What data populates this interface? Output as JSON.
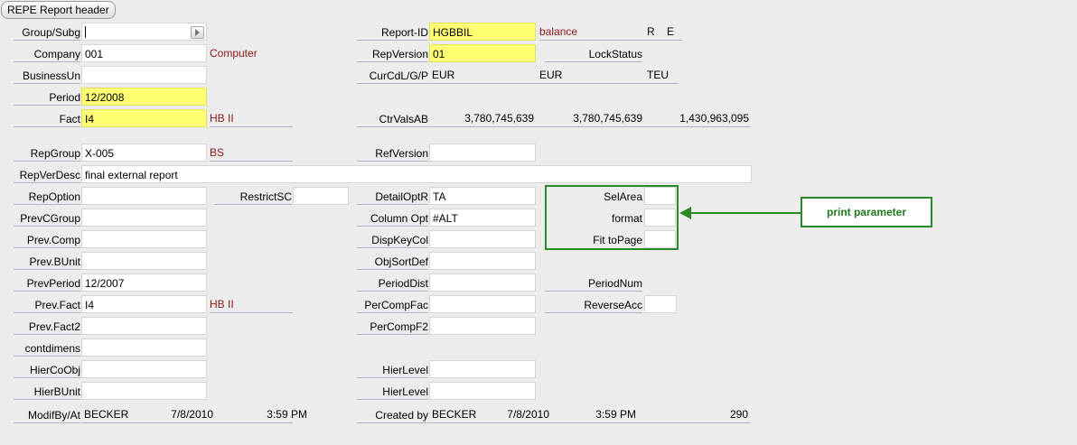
{
  "window": {
    "tab_title": "REPE Report header"
  },
  "left": {
    "group_subg": {
      "label": "Group/Subg",
      "value": ""
    },
    "company": {
      "label": "Company",
      "value": "001",
      "desc": "Computer"
    },
    "business_unit": {
      "label": "BusinessUn",
      "value": ""
    },
    "period": {
      "label": "Period",
      "value": "12/2008"
    },
    "fact": {
      "label": "Fact",
      "value": "I4",
      "desc": "HB II"
    },
    "rep_group": {
      "label": "RepGroup",
      "value": "X-005",
      "desc": "BS"
    },
    "rep_ver_desc": {
      "label": "RepVerDesc",
      "value": "final external report"
    },
    "rep_option": {
      "label": "RepOption",
      "value": ""
    },
    "restrict_sc": {
      "label": "RestrictSC",
      "value": ""
    },
    "prev_cgroup": {
      "label": "PrevCGroup",
      "value": ""
    },
    "prev_comp": {
      "label": "Prev.Comp",
      "value": ""
    },
    "prev_bunit": {
      "label": "Prev.BUnit",
      "value": ""
    },
    "prev_period": {
      "label": "PrevPeriod",
      "value": "12/2007"
    },
    "prev_fact": {
      "label": "Prev.Fact",
      "value": "I4",
      "desc": "HB II"
    },
    "prev_fact2": {
      "label": "Prev.Fact2",
      "value": ""
    },
    "contdimens": {
      "label": "contdimens",
      "value": ""
    },
    "hier_coobj": {
      "label": "HierCoObj",
      "value": ""
    },
    "hier_bunit": {
      "label": "HierBUnit",
      "value": ""
    },
    "modif": {
      "label": "ModifBy/At",
      "user": "BECKER",
      "date": "7/8/2010",
      "time": "3:59 PM"
    }
  },
  "right": {
    "report_id": {
      "label": "Report-ID",
      "value": "HGBBIL",
      "desc": "balance",
      "flag1": "R",
      "flag2": "E"
    },
    "rep_version": {
      "label": "RepVersion",
      "value": "01"
    },
    "lock_status": {
      "label": "LockStatus",
      "value": ""
    },
    "curcd": {
      "label": "CurCdL/G/P",
      "v1": "EUR",
      "v2": "EUR",
      "v3": "TEU"
    },
    "ctr_vals": {
      "label": "CtrValsAB",
      "v1": "3,780,745,639",
      "v2": "3,780,745,639",
      "v3": "1,430,963,095"
    },
    "ref_version": {
      "label": "RefVersion",
      "value": ""
    },
    "detail_optr": {
      "label": "DetailOptR",
      "value": "TA"
    },
    "column_opt": {
      "label": "Column Opt",
      "value": "#ALT"
    },
    "disp_key_col": {
      "label": "DispKeyCol",
      "value": ""
    },
    "obj_sort_def": {
      "label": "ObjSortDef",
      "value": ""
    },
    "period_dist": {
      "label": "PeriodDist",
      "value": ""
    },
    "per_comp_fac": {
      "label": "PerCompFac",
      "value": ""
    },
    "per_comp_f2": {
      "label": "PerCompF2",
      "value": ""
    },
    "hier_level1": {
      "label": "HierLevel",
      "value": ""
    },
    "hier_level2": {
      "label": "HierLevel",
      "value": ""
    },
    "created": {
      "label": "Created by",
      "user": "BECKER",
      "date": "7/8/2010",
      "time": "3:59 PM",
      "count": "290"
    }
  },
  "print": {
    "sel_area": {
      "label": "SelArea",
      "value": ""
    },
    "format": {
      "label": "format",
      "value": ""
    },
    "fit_to_page": {
      "label": "Fit toPage",
      "value": ""
    },
    "period_num": {
      "label": "PeriodNum",
      "value": ""
    },
    "reverse_acc": {
      "label": "ReverseAcc",
      "value": ""
    }
  },
  "annotation": {
    "label": "print parameter",
    "color": "#2a8a2a"
  }
}
